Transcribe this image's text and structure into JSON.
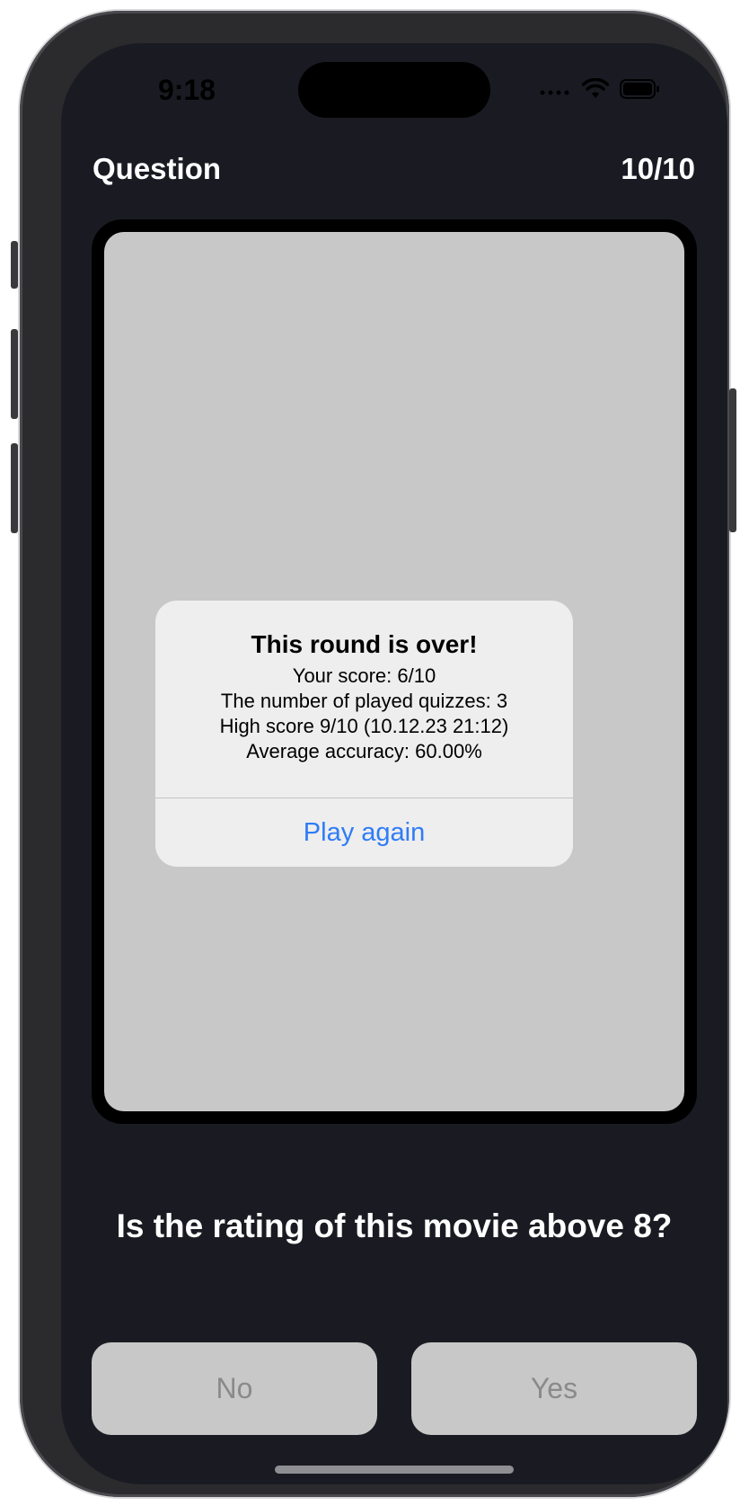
{
  "status_bar": {
    "time": "9:18",
    "icons": [
      "signal-icon",
      "wifi-icon",
      "battery-icon"
    ]
  },
  "header": {
    "title": "Question",
    "counter": "10/10"
  },
  "alert": {
    "title": "This round is over!",
    "lines": [
      "Your score: 6/10",
      "The number of played quizzes: 3",
      "High score 9/10 (10.12.23 21:12)",
      "Average accuracy: 60.00%"
    ],
    "button": "Play again"
  },
  "question": "Is the rating of this movie above 8?",
  "buttons": {
    "no": "No",
    "yes": "Yes"
  },
  "colors": {
    "background": "#1a1b22",
    "poster_placeholder": "#c8c8c8",
    "alert_background": "#eeeeee",
    "link_blue": "#2f7cf6",
    "button_text_disabled": "#8a8a8a"
  }
}
